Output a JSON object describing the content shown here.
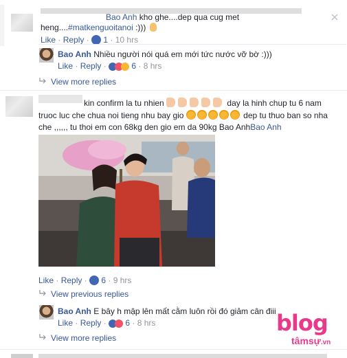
{
  "comments": [
    {
      "author": "Bao Anh",
      "text_line1": " kho ghe....dep qua cug met",
      "text_line2": "heng....",
      "hashtag": "#matkenguoitanoi",
      "text_tail": " :)))",
      "like": "Like",
      "reply": "Reply",
      "count": "1",
      "time": "10 hrs",
      "replies": [
        {
          "author": "Bao Anh",
          "text": "Nhiều người nói quá em mới tức nước vỡ bờ :)))",
          "like": "Like",
          "reply": "Reply",
          "count": "6",
          "time": "8 hrs"
        }
      ],
      "view_more": "View more replies"
    },
    {
      "line1_a": "kin confirm la tu nhien",
      "line1_b": "day la hinh chup tu 6 nam",
      "line2_a": "truoc luc che chua noi tieng nhu bay gio",
      "line2_b": "dep tu thuo ban so nha",
      "line3": "che ,,,,,, tu thoi em con 68kg den gio em da 90kg Bao Anh",
      "line3_link": "Bao Anh",
      "like": "Like",
      "reply": "Reply",
      "count": "6",
      "time": "9 hrs",
      "view_previous": "View previous replies",
      "replies": [
        {
          "author": "Bao Anh",
          "text": "E bây h mập lên mất cằm luôn rồi đó giảm cân điii",
          "like": "Like",
          "reply": "Reply",
          "count": "6",
          "time": "8 hrs"
        }
      ],
      "view_more": "View more replies"
    }
  ],
  "watermark": {
    "main": "blog",
    "sub": "tâmsự",
    "suffix": ".vn"
  },
  "colors": {
    "link": "#365899",
    "meta": "#90949c",
    "like_blue": "#4267b2",
    "love_red": "#f25268",
    "watermark_pink": "#e8398b"
  }
}
